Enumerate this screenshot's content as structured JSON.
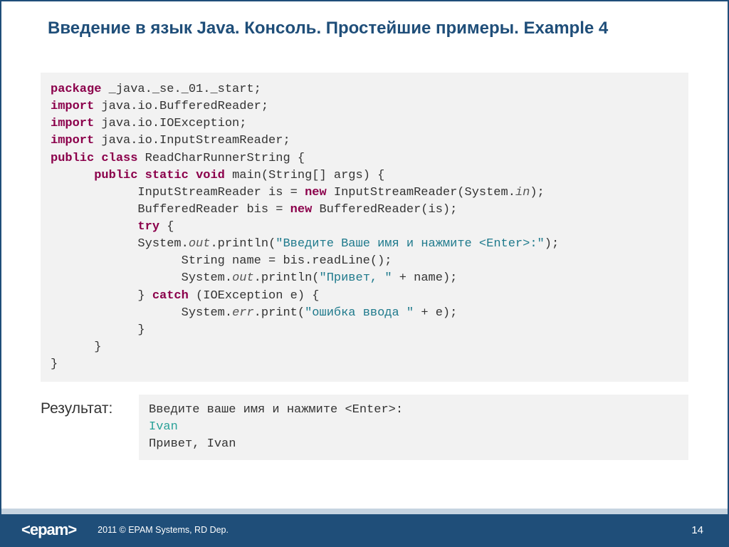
{
  "title": "Введение в язык Java. Консоль. Простейшие примеры. Example 4",
  "code": {
    "kw_package": "package",
    "pkg_path": " _java._se._01._start;",
    "kw_import1": "import",
    "import1": " java.io.BufferedReader;",
    "kw_import2": "import",
    "import2": " java.io.IOException;",
    "kw_import3": "import",
    "import3": " java.io.InputStreamReader;",
    "kw_public": "public",
    "kw_class": "class",
    "class_name": " ReadCharRunnerString {",
    "indent6": "      ",
    "kw_public2": "public",
    "kw_static": "static",
    "kw_void": "void",
    "main_sig": " main(String[] args) {",
    "indent12": "            ",
    "isr_pre": "InputStreamReader is = ",
    "kw_new1": "new",
    "isr_post": " InputStreamReader(System.",
    "it_in": "in",
    "isr_end": ");",
    "bis_pre": "BufferedReader bis = ",
    "kw_new2": "new",
    "bis_post": " BufferedReader(is);",
    "kw_try": "try",
    "try_brace": " {",
    "sysout_pre": "System.",
    "it_out": "out",
    "println_open": ".println(",
    "str_prompt": "\"Введите Ваше имя и нажмите <Enter>:\"",
    "println_close": ");",
    "indent18": "                  ",
    "readline": "String name = bis.readLine();",
    "sysout2_pre": "System.",
    "it_out2": "out",
    "println2_open": ".println(",
    "str_hello": "\"Привет, \"",
    "println2_post": " + name);",
    "brace_close12": "            } ",
    "kw_catch": "catch",
    "catch_sig": " (IOException e) {",
    "syserr_pre": "System.",
    "it_err": "err",
    "print_open": ".print(",
    "str_err": "\"ошибка ввода \"",
    "print_post": " + e);",
    "brace12": "            }",
    "brace6": "      }",
    "brace0": "}"
  },
  "result_label": "Результат:",
  "output": {
    "line1": "Введите ваше имя и нажмите <Enter>:",
    "line2": "Ivan",
    "line3": "Привет, Ivan"
  },
  "footer": {
    "logo": "<epam>",
    "copyright": "2011 © EPAM Systems, RD Dep.",
    "page": "14"
  }
}
